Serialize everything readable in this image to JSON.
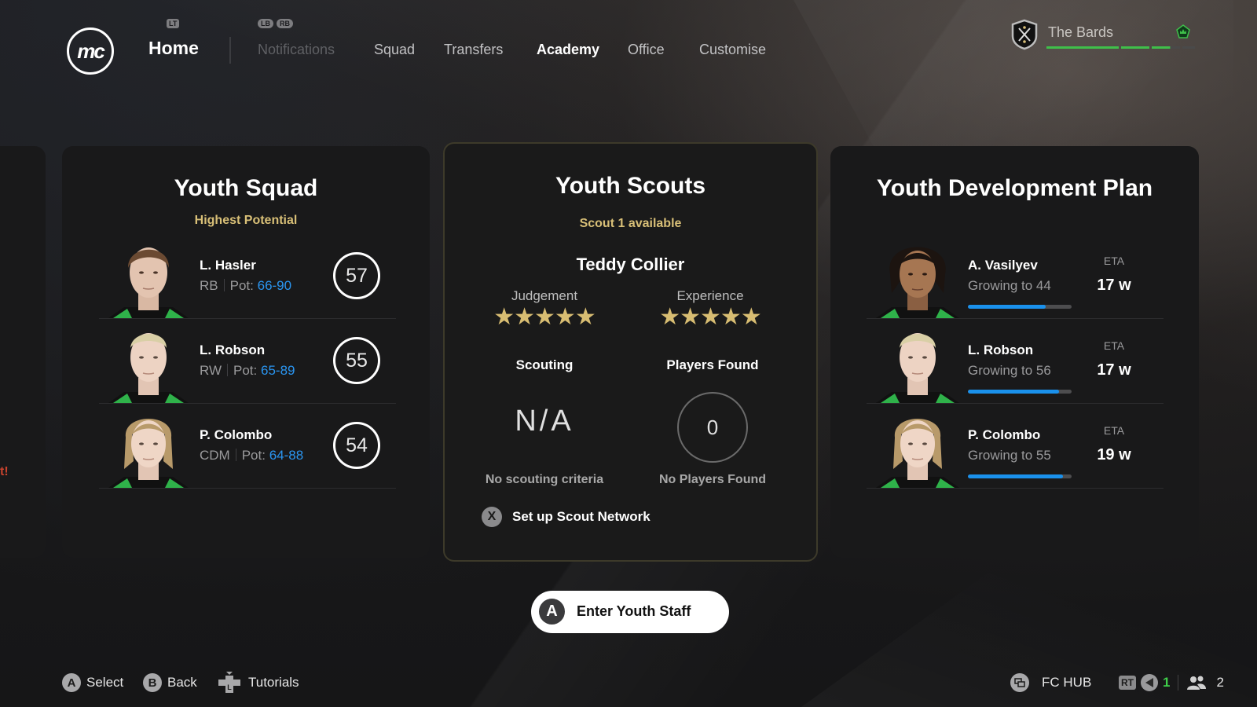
{
  "nav": {
    "home_label": "Home",
    "home_hint": "LT",
    "tab_hints": [
      "LB",
      "RB"
    ],
    "tabs": [
      {
        "label": "Notifications",
        "state": "disabled"
      },
      {
        "label": "Squad",
        "state": "normal"
      },
      {
        "label": "Transfers",
        "state": "normal"
      },
      {
        "label": "Academy",
        "state": "active"
      },
      {
        "label": "Office",
        "state": "normal"
      },
      {
        "label": "Customise",
        "state": "normal"
      }
    ],
    "logo_text": "mc",
    "club": {
      "name": "The Bards",
      "progress_segments": [
        1,
        1,
        0.6,
        0
      ]
    }
  },
  "edge_warning": "t!",
  "youth_squad": {
    "title": "Youth Squad",
    "subtitle": "Highest Potential",
    "players": [
      {
        "name": "L. Hasler",
        "position": "RB",
        "pot_label": "Pot:",
        "potential": "66-90",
        "rating": "57"
      },
      {
        "name": "L. Robson",
        "position": "RW",
        "pot_label": "Pot:",
        "potential": "65-89",
        "rating": "55"
      },
      {
        "name": "P. Colombo",
        "position": "CDM",
        "pot_label": "Pot:",
        "potential": "64-88",
        "rating": "54"
      }
    ]
  },
  "youth_scouts": {
    "title": "Youth Scouts",
    "subtitle": "Scout 1 available",
    "scout_name": "Teddy Collier",
    "judgement_label": "Judgement",
    "judgement_stars": 5,
    "experience_label": "Experience",
    "experience_stars": 5,
    "scouting_label": "Scouting",
    "scouting_value": "N/A",
    "scouting_sub": "No scouting criteria",
    "found_label": "Players Found",
    "found_value": "0",
    "found_sub": "No Players Found",
    "action_button": "X",
    "action_label": "Set up Scout Network"
  },
  "development": {
    "title": "Youth Development Plan",
    "eta_label": "ETA",
    "players": [
      {
        "name": "A. Vasilyev",
        "growing": "Growing to 44",
        "progress": 0.75,
        "eta": "17 w"
      },
      {
        "name": "L. Robson",
        "growing": "Growing to 56",
        "progress": 0.88,
        "eta": "17 w"
      },
      {
        "name": "P. Colombo",
        "growing": "Growing to 55",
        "progress": 0.92,
        "eta": "19 w"
      }
    ]
  },
  "enter_button": {
    "key": "A",
    "label": "Enter Youth Staff"
  },
  "footer": {
    "select": {
      "key": "A",
      "label": "Select"
    },
    "back": {
      "key": "B",
      "label": "Back"
    },
    "tutorials": {
      "label": "Tutorials"
    },
    "fc_hub": "FC HUB",
    "rt_hint": "RT",
    "notif_count": "1",
    "friends_count": "2"
  },
  "colors": {
    "accent_gold": "#d8bf77",
    "potential_blue": "#2a95f0",
    "progress_blue": "#1a91ec",
    "club_green": "#3fbf4a"
  }
}
